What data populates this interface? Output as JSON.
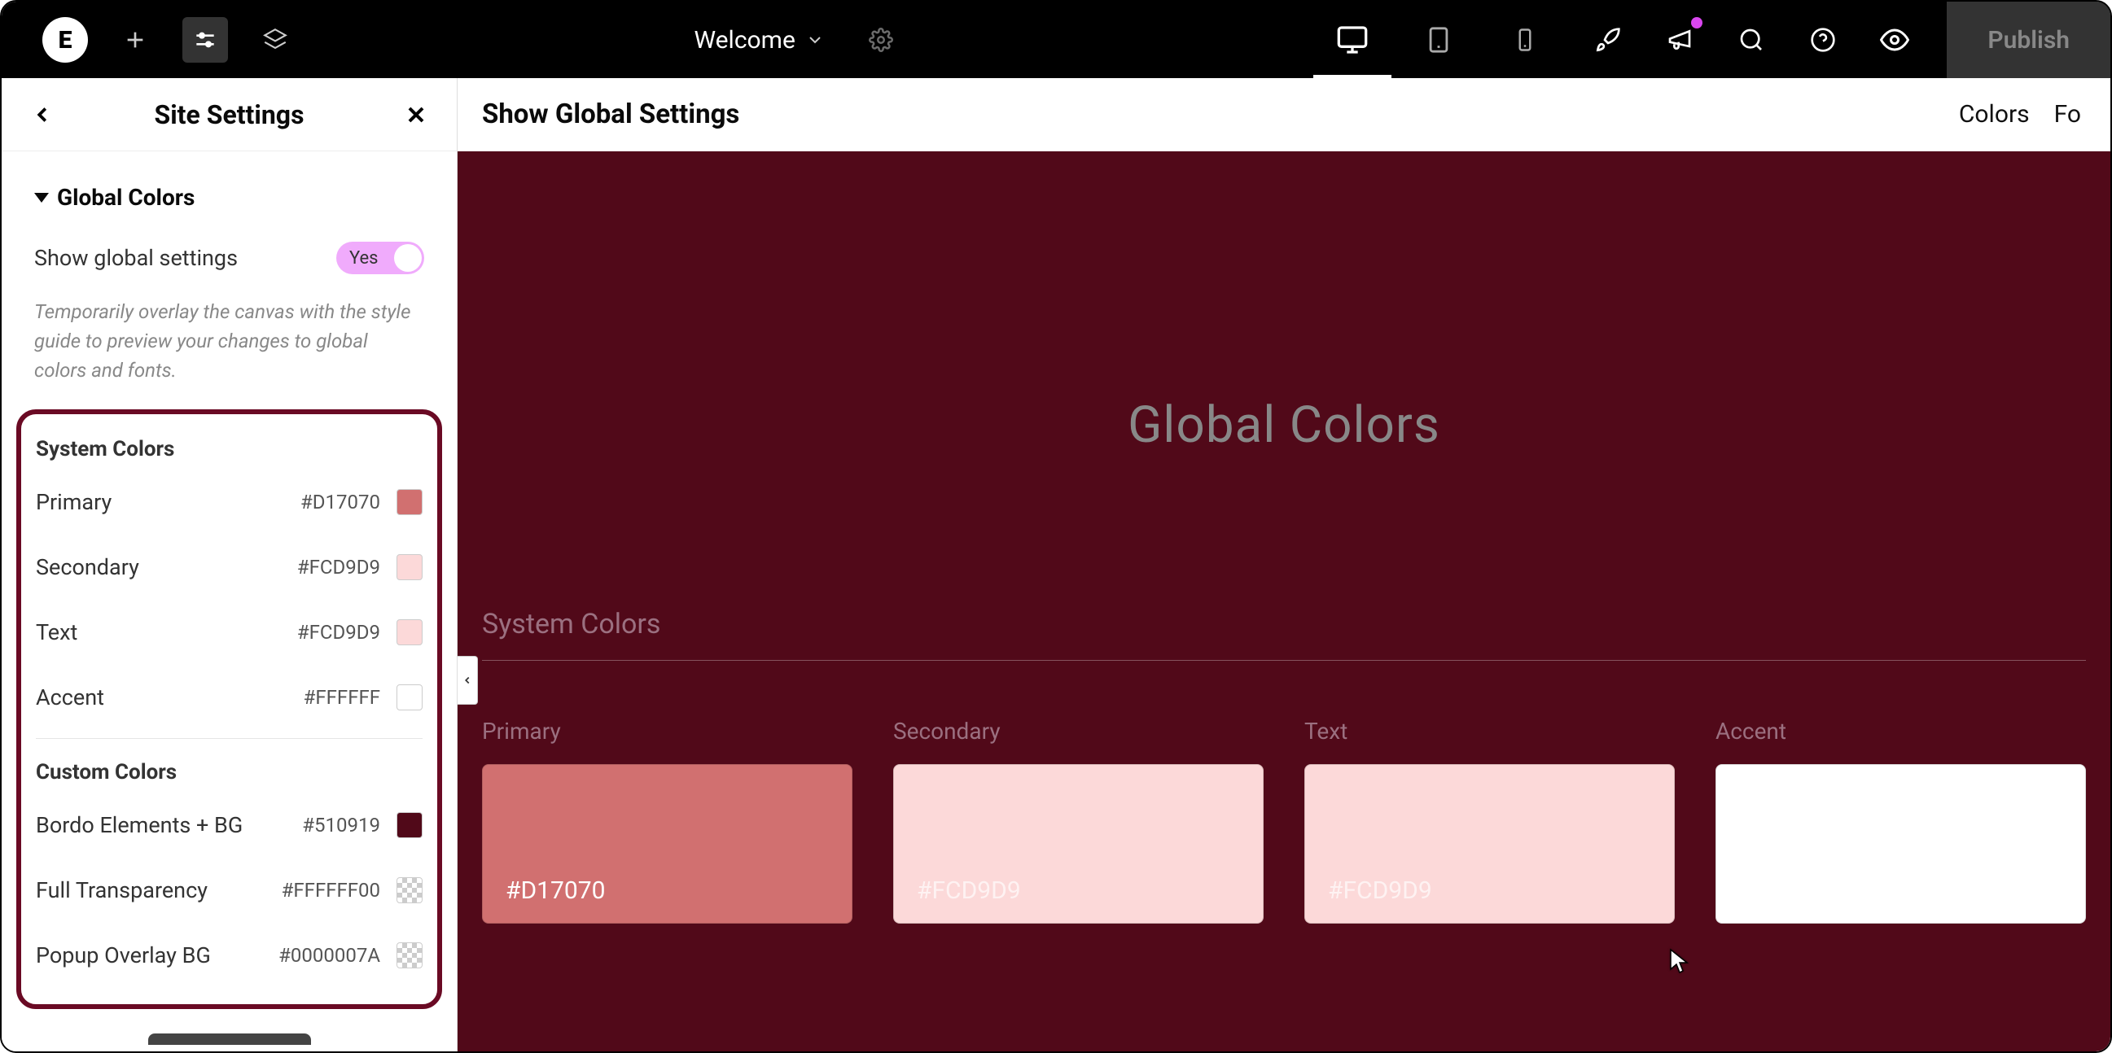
{
  "topbar": {
    "page_name": "Welcome",
    "publish_label": "Publish"
  },
  "sidebar": {
    "title": "Site Settings",
    "section": "Global Colors",
    "toggle_label": "Show global settings",
    "toggle_value": "Yes",
    "help_text": "Temporarily overlay the canvas with the style guide to preview your changes to global colors and fonts.",
    "system_colors_title": "System Colors",
    "system_colors": [
      {
        "name": "Primary",
        "hex": "#D17070",
        "swatch": "#D17070"
      },
      {
        "name": "Secondary",
        "hex": "#FCD9D9",
        "swatch": "#FCD9D9"
      },
      {
        "name": "Text",
        "hex": "#FCD9D9",
        "swatch": "#FCD9D9"
      },
      {
        "name": "Accent",
        "hex": "#FFFFFF",
        "swatch": "#FFFFFF"
      }
    ],
    "custom_colors_title": "Custom Colors",
    "custom_colors": [
      {
        "name": "Bordo Elements + BG",
        "hex": "#510919",
        "swatch": "#510919",
        "checker": false
      },
      {
        "name": "Full Transparency",
        "hex": "#FFFFFF00",
        "swatch": "",
        "checker": true
      },
      {
        "name": "Popup Overlay BG",
        "hex": "#0000007A",
        "swatch": "",
        "checker": true
      }
    ]
  },
  "main": {
    "header_title": "Show Global Settings",
    "tab_colors": "Colors",
    "tab_fonts": "Fo",
    "canvas_title": "Global Colors",
    "canvas_section": "System Colors",
    "cards": [
      {
        "label": "Primary",
        "hex": "#D17070",
        "bg": "#D17070",
        "textClass": ""
      },
      {
        "label": "Secondary",
        "hex": "#FCD9D9",
        "bg": "#FCD9D9",
        "textClass": "light-text"
      },
      {
        "label": "Text",
        "hex": "#FCD9D9",
        "bg": "#FCD9D9",
        "textClass": "light-text"
      },
      {
        "label": "Accent",
        "hex": "",
        "bg": "#FFFFFF",
        "textClass": ""
      }
    ]
  }
}
